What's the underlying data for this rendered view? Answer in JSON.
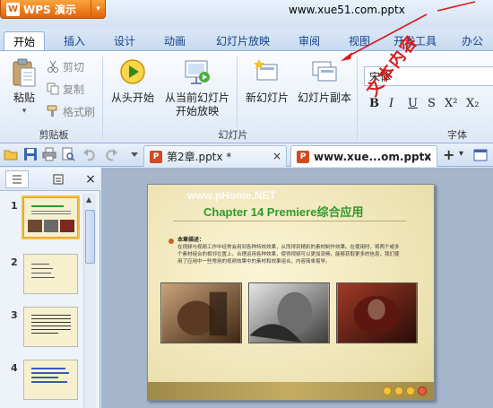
{
  "app": {
    "name": "WPS 演示",
    "logo_letter": "W",
    "dropdown_glyph": "▾"
  },
  "window_title": "www.xue51.com.pptx",
  "ribbon_tabs": [
    {
      "label": "开始",
      "active": true
    },
    {
      "label": "插入"
    },
    {
      "label": "设计"
    },
    {
      "label": "动画"
    },
    {
      "label": "幻灯片放映"
    },
    {
      "label": "审阅"
    },
    {
      "label": "视图"
    },
    {
      "label": "开发工具"
    },
    {
      "label": "办公"
    }
  ],
  "clipboard": {
    "paste_label": "粘贴",
    "paste_dropdown": "▾",
    "cut_label": "剪切",
    "copy_label": "复制",
    "format_painter_label": "格式刷",
    "group_label": "剪贴板"
  },
  "slideshow": {
    "from_start_label": "从头开始",
    "from_current_line1": "从当前幻灯片",
    "from_current_line2": "开始放映",
    "group_label": "幻灯片"
  },
  "slides": {
    "new_slide_label": "新幻灯片",
    "duplicate_slide_label": "幻灯片副本"
  },
  "font": {
    "current_font": "宋体",
    "bold": "B",
    "italic": "I",
    "underline": "U",
    "strike": "S",
    "superscript": "X²",
    "subscript": "X₂",
    "group_label": "字体"
  },
  "doc_tabs": [
    {
      "label": "第2章.pptx *",
      "close": "×",
      "active": false
    },
    {
      "label": "www.xue...om.pptx",
      "close": "×",
      "active": true
    }
  ],
  "new_tab_glyph": "+",
  "tab_menu_glyph": "▾",
  "panel": {
    "close_glyph": "×"
  },
  "thumbnails": [
    {
      "num": "1",
      "selected": true
    },
    {
      "num": "2",
      "selected": false
    },
    {
      "num": "3",
      "selected": false
    },
    {
      "num": "4",
      "selected": false
    }
  ],
  "slide": {
    "watermark": "www.pHome.NET",
    "title": "Chapter 14  Premiere综合应用",
    "heading": "本章描述：",
    "body": "在视频与视频工作中经常会用到各种特效效果，从而得到精彩的素材制作效果。在使用时，将两个或多个素材组合的相邻位置上，合理运用各种效果，使得视频可以更加流畅，能够获取更多的信息，我们使用了应用中一些常用的视频效果中的素材和效果组合，内容简单易学。"
  },
  "annotation": "文本内容",
  "colors": {
    "accent": "#f0841c",
    "ribbon_text": "#15428b",
    "annotation_red": "#d61c1c",
    "slide_title_green": "#2e9a2e"
  }
}
